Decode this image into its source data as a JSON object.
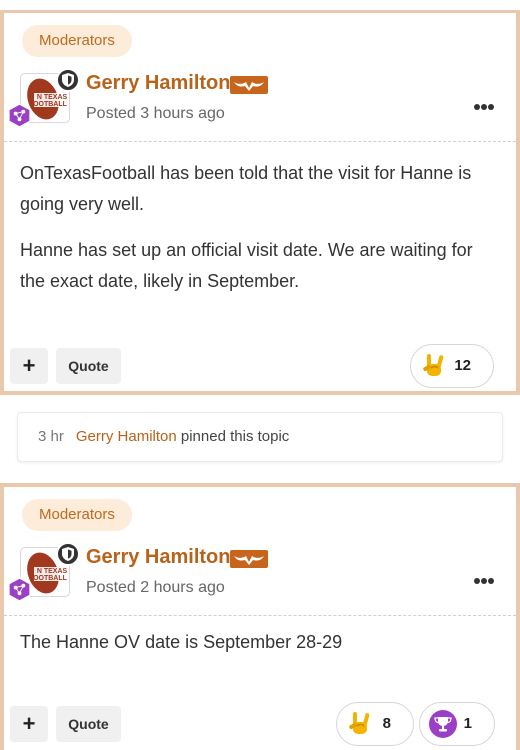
{
  "posts": [
    {
      "group": "Moderators",
      "author": "Gerry Hamilton",
      "avatar_text": "ON TEXAS FOOTBALL",
      "posted": "Posted 3 hours ago",
      "paragraphs": [
        "OnTexasFootball has been told that the visit for Hanne is going very well.",
        "Hanne has set up an official visit date. We are waiting for the exact date, likely in September."
      ],
      "quote_label": "Quote",
      "reactions": [
        {
          "icon": "horns-hand-icon",
          "count": "12"
        }
      ]
    },
    {
      "group": "Moderators",
      "author": "Gerry Hamilton",
      "avatar_text": "ON TEXAS FOOTBALL",
      "posted": "Posted 2 hours ago",
      "paragraphs": [
        "The Hanne OV date is September 28-29"
      ],
      "quote_label": "Quote",
      "reactions": [
        {
          "icon": "horns-hand-icon",
          "count": "8"
        },
        {
          "icon": "trophy-icon",
          "count": "1"
        }
      ]
    }
  ],
  "activity": {
    "time": "3 hr",
    "user": "Gerry Hamilton",
    "action": " pinned this topic"
  },
  "colors": {
    "accent": "#b8621a",
    "post_border": "#e9c8ab",
    "badge_bg": "#fcecd9",
    "rank_purple": "#9b3fc5"
  }
}
